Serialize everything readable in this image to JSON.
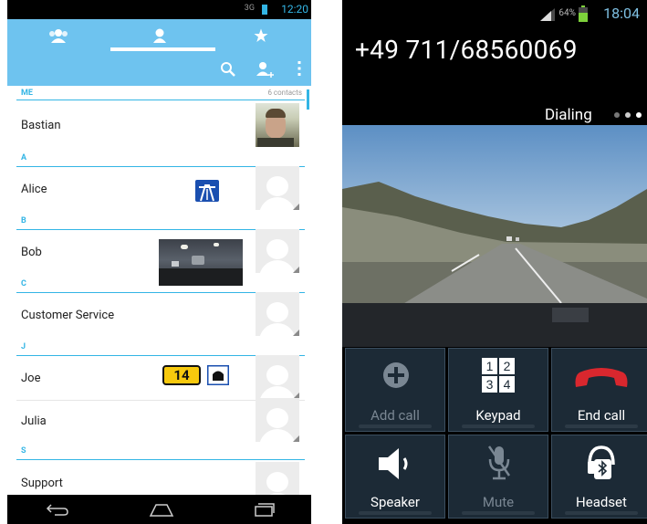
{
  "left": {
    "status": {
      "network": "3G",
      "time": "12:20"
    },
    "tabs": [
      {
        "icon": "group-icon",
        "selected": false
      },
      {
        "icon": "person-icon",
        "selected": true
      },
      {
        "icon": "star-icon",
        "selected": false
      }
    ],
    "actions": [
      "search-icon",
      "add-contact-icon",
      "overflow-menu-icon"
    ],
    "me_header": {
      "label": "ME",
      "count": "6 contacts"
    },
    "contacts": [
      {
        "section": "",
        "name": "Bastian"
      },
      {
        "section": "A",
        "name": "Alice"
      },
      {
        "section": "B",
        "name": "Bob"
      },
      {
        "section": "C",
        "name": "Customer Service"
      },
      {
        "section": "J",
        "name": "Joe"
      },
      {
        "section": "",
        "name": "Julia"
      },
      {
        "section": "S",
        "name": "Support"
      }
    ],
    "badges": {
      "joe_plate": "14"
    },
    "nav": [
      "back-icon",
      "home-icon",
      "recents-icon"
    ],
    "colors": {
      "accent": "#33b5e5",
      "bar": "#6ec3ef"
    }
  },
  "right": {
    "status": {
      "battery": "64%",
      "time": "18:04"
    },
    "number": "+49 711/68560069",
    "state": "Dialing",
    "buttons": [
      {
        "label": "Add call",
        "enabled": false,
        "icon": "add-call-icon"
      },
      {
        "label": "Keypad",
        "enabled": true,
        "icon": "keypad-icon",
        "keys": [
          "1",
          "2",
          "3",
          "4"
        ]
      },
      {
        "label": "End call",
        "enabled": true,
        "icon": "end-call-icon"
      },
      {
        "label": "Speaker",
        "enabled": true,
        "icon": "speaker-icon"
      },
      {
        "label": "Mute",
        "enabled": false,
        "icon": "mute-icon"
      },
      {
        "label": "Headset",
        "enabled": true,
        "icon": "bluetooth-headset-icon"
      }
    ],
    "colors": {
      "end_call": "#d9272e",
      "time": "#7ec0e3",
      "button_bg": "#1c2a36"
    }
  }
}
